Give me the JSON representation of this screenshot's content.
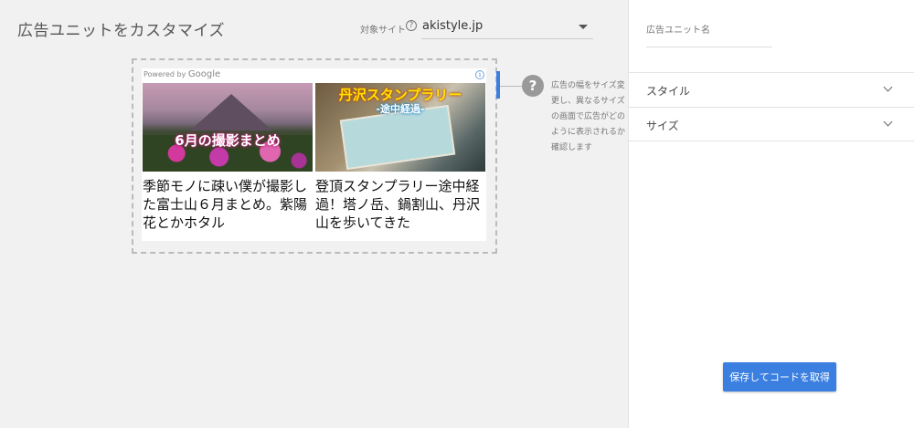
{
  "page_title": "広告ユニットをカスタマイズ",
  "site_selector": {
    "label": "対象サイト",
    "help_icon": "?",
    "value": "akistyle.jp"
  },
  "preview": {
    "powered_by": "Powered by",
    "powered_brand": "Google",
    "info_icon": "i",
    "ads": [
      {
        "image_text": "6月の撮影まとめ",
        "title": "季節モノに疎い僕が撮影した富士山６月まとめ。紫陽花とかホタル"
      },
      {
        "image_text": "丹沢スタンプラリー",
        "image_subtext": "-途中経過-",
        "title": "登頂スタンプラリー途中経過！塔ノ岳、鍋割山、丹沢山を歩いてきた"
      }
    ],
    "help_big_icon": "?",
    "help_text": [
      "広告の幅をサイズ変",
      "更し、異なるサイズ",
      "の画面で広告がどの",
      "ように表示されるか",
      "確認します"
    ]
  },
  "panel": {
    "adunit_name_label": "広告ユニット名",
    "adunit_name_value": "",
    "sections": [
      {
        "label": "スタイル"
      },
      {
        "label": "サイズ"
      }
    ],
    "save_button": "保存してコードを取得"
  },
  "colors": {
    "accent": "#3b7fe0",
    "background": "#f1f1f1",
    "panel": "#ffffff"
  }
}
